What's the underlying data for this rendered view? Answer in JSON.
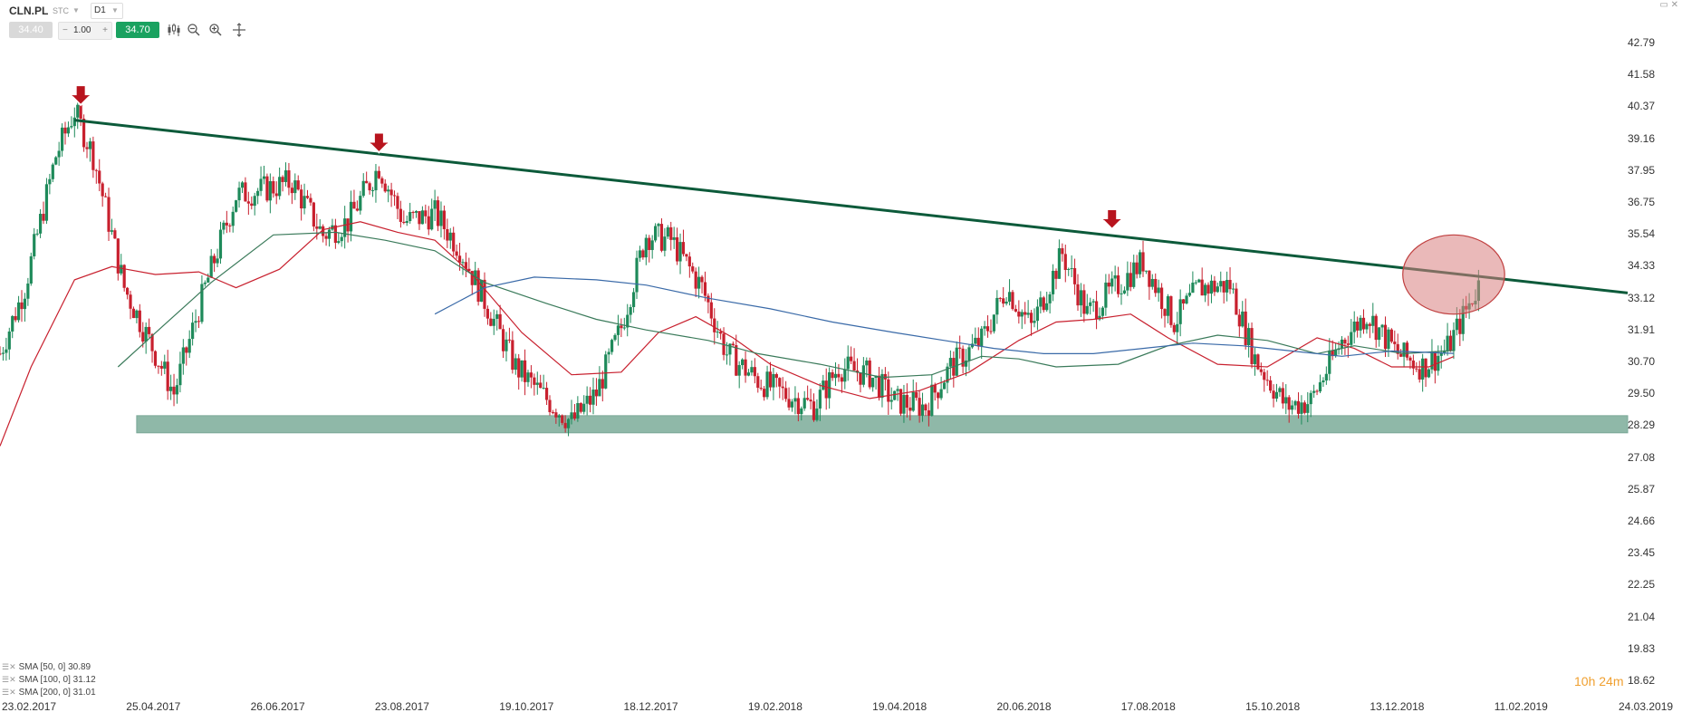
{
  "header": {
    "symbol": "CLN.PL",
    "market": "STC",
    "timeframe": "D1",
    "sell_price": "34.40",
    "volume": "1.00",
    "volume_minus": "−",
    "volume_plus": "+",
    "buy_price": "34.70"
  },
  "icons": {
    "chart_type": "candlestick-icon",
    "zoom_out": "zoom-out-icon",
    "zoom_in": "zoom-in-icon",
    "crosshair": "crosshair-icon"
  },
  "timer": "10h 24m",
  "colors": {
    "up": "#1e8a5a",
    "down": "#c8202e",
    "trendline": "#0c5a3a",
    "support_zone": "#8fb8a8",
    "sma50": "#c8202e",
    "sma100": "#3a7a5a",
    "sma200": "#3a6aa8",
    "highlight_circle": "#d98080",
    "arrow": "#b8141e"
  },
  "legend": [
    {
      "label": "SMA [50, 0] 30.89"
    },
    {
      "label": "SMA [100, 0] 31.12"
    },
    {
      "label": "SMA [200, 0] 31.01"
    }
  ],
  "chart_data": {
    "type": "candlestick",
    "x_ticks": [
      "23.02.2017",
      "25.04.2017",
      "26.06.2017",
      "23.08.2017",
      "19.10.2017",
      "18.12.2017",
      "19.02.2018",
      "19.04.2018",
      "20.06.2018",
      "17.08.2018",
      "15.10.2018",
      "13.12.2018",
      "11.02.2019",
      "24.03.2019"
    ],
    "y_ticks": [
      "42.79",
      "41.58",
      "40.37",
      "39.16",
      "37.95",
      "36.75",
      "35.54",
      "34.33",
      "33.12",
      "31.91",
      "30.70",
      "29.50",
      "28.29",
      "27.08",
      "25.87",
      "24.66",
      "23.45",
      "22.25",
      "21.04",
      "19.83",
      "18.62"
    ],
    "ylim": [
      18.62,
      42.79
    ],
    "price_path": [
      [
        0,
        31.0
      ],
      [
        4,
        33.5
      ],
      [
        9,
        38.5
      ],
      [
        12,
        40.2
      ],
      [
        15,
        38.5
      ],
      [
        20,
        33.5
      ],
      [
        24,
        31.5
      ],
      [
        28,
        29.5
      ],
      [
        33,
        33.5
      ],
      [
        38,
        37.0
      ],
      [
        42,
        37.2
      ],
      [
        47,
        37.5
      ],
      [
        52,
        35.5
      ],
      [
        56,
        36.0
      ],
      [
        61,
        38.1
      ],
      [
        65,
        36.0
      ],
      [
        70,
        36.3
      ],
      [
        74,
        35.0
      ],
      [
        78,
        33.0
      ],
      [
        83,
        30.5
      ],
      [
        87,
        29.5
      ],
      [
        92,
        28.4
      ],
      [
        96,
        29.5
      ],
      [
        100,
        32.0
      ],
      [
        104,
        35.5
      ],
      [
        108,
        35.3
      ],
      [
        113,
        33.5
      ],
      [
        117,
        31.0
      ],
      [
        122,
        30.0
      ],
      [
        126,
        29.5
      ],
      [
        131,
        29.0
      ],
      [
        135,
        30.5
      ],
      [
        140,
        30.2
      ],
      [
        144,
        29.2
      ],
      [
        149,
        29.0
      ],
      [
        153,
        30.5
      ],
      [
        158,
        31.5
      ],
      [
        162,
        33.5
      ],
      [
        166,
        32.0
      ],
      [
        171,
        34.8
      ],
      [
        175,
        32.5
      ],
      [
        180,
        33.6
      ],
      [
        184,
        34.5
      ],
      [
        189,
        32.2
      ],
      [
        193,
        33.5
      ],
      [
        198,
        33.6
      ],
      [
        202,
        30.8
      ],
      [
        207,
        29.0
      ],
      [
        211,
        29.2
      ],
      [
        216,
        31.5
      ],
      [
        220,
        32.5
      ],
      [
        225,
        31.0
      ],
      [
        229,
        30.5
      ],
      [
        233,
        31.2
      ],
      [
        238,
        33.6
      ]
    ],
    "sma50": [
      [
        0,
        27.5
      ],
      [
        5,
        30.5
      ],
      [
        12,
        33.8
      ],
      [
        18,
        34.3
      ],
      [
        25,
        34.0
      ],
      [
        32,
        34.1
      ],
      [
        38,
        33.5
      ],
      [
        45,
        34.2
      ],
      [
        52,
        35.7
      ],
      [
        58,
        36.0
      ],
      [
        64,
        35.6
      ],
      [
        70,
        35.3
      ],
      [
        76,
        34.0
      ],
      [
        84,
        31.8
      ],
      [
        92,
        30.2
      ],
      [
        100,
        30.3
      ],
      [
        106,
        31.8
      ],
      [
        112,
        32.4
      ],
      [
        118,
        31.6
      ],
      [
        124,
        30.6
      ],
      [
        132,
        29.8
      ],
      [
        140,
        29.3
      ],
      [
        148,
        29.6
      ],
      [
        156,
        30.3
      ],
      [
        164,
        31.5
      ],
      [
        170,
        32.2
      ],
      [
        176,
        32.3
      ],
      [
        182,
        32.5
      ],
      [
        188,
        31.6
      ],
      [
        196,
        30.6
      ],
      [
        204,
        30.5
      ],
      [
        212,
        31.6
      ],
      [
        218,
        31.2
      ],
      [
        224,
        30.5
      ],
      [
        230,
        30.5
      ],
      [
        234,
        30.89
      ]
    ],
    "sma100": [
      [
        19,
        30.5
      ],
      [
        26,
        32.0
      ],
      [
        34,
        33.7
      ],
      [
        44,
        35.5
      ],
      [
        54,
        35.6
      ],
      [
        62,
        35.3
      ],
      [
        70,
        34.9
      ],
      [
        78,
        33.7
      ],
      [
        88,
        32.9
      ],
      [
        96,
        32.3
      ],
      [
        104,
        31.9
      ],
      [
        114,
        31.5
      ],
      [
        122,
        31.0
      ],
      [
        132,
        30.6
      ],
      [
        142,
        30.1
      ],
      [
        150,
        30.2
      ],
      [
        158,
        30.9
      ],
      [
        164,
        30.8
      ],
      [
        170,
        30.5
      ],
      [
        180,
        30.6
      ],
      [
        188,
        31.3
      ],
      [
        196,
        31.7
      ],
      [
        204,
        31.5
      ],
      [
        212,
        31.0
      ],
      [
        218,
        31.3
      ],
      [
        226,
        31.0
      ],
      [
        234,
        31.12
      ]
    ],
    "sma200": [
      [
        70,
        32.5
      ],
      [
        78,
        33.5
      ],
      [
        86,
        33.9
      ],
      [
        96,
        33.8
      ],
      [
        104,
        33.6
      ],
      [
        114,
        33.1
      ],
      [
        124,
        32.7
      ],
      [
        134,
        32.2
      ],
      [
        144,
        31.8
      ],
      [
        152,
        31.5
      ],
      [
        160,
        31.2
      ],
      [
        168,
        31.0
      ],
      [
        176,
        31.0
      ],
      [
        184,
        31.2
      ],
      [
        192,
        31.4
      ],
      [
        200,
        31.3
      ],
      [
        208,
        31.1
      ],
      [
        216,
        30.9
      ],
      [
        224,
        31.1
      ],
      [
        234,
        31.01
      ]
    ],
    "trendline": [
      [
        12,
        39.85
      ],
      [
        262,
        33.3
      ]
    ],
    "support_zone": [
      28.0,
      28.65
    ],
    "support_zone_x": [
      22,
      262
    ],
    "resistance_arrows": [
      [
        13,
        40.4
      ],
      [
        61,
        38.6
      ],
      [
        179,
        35.7
      ]
    ],
    "highlight": {
      "x": 234,
      "y": 34.0,
      "rx": 8.2,
      "ry": 1.5
    },
    "x_range": [
      0,
      262
    ],
    "grid": false
  }
}
